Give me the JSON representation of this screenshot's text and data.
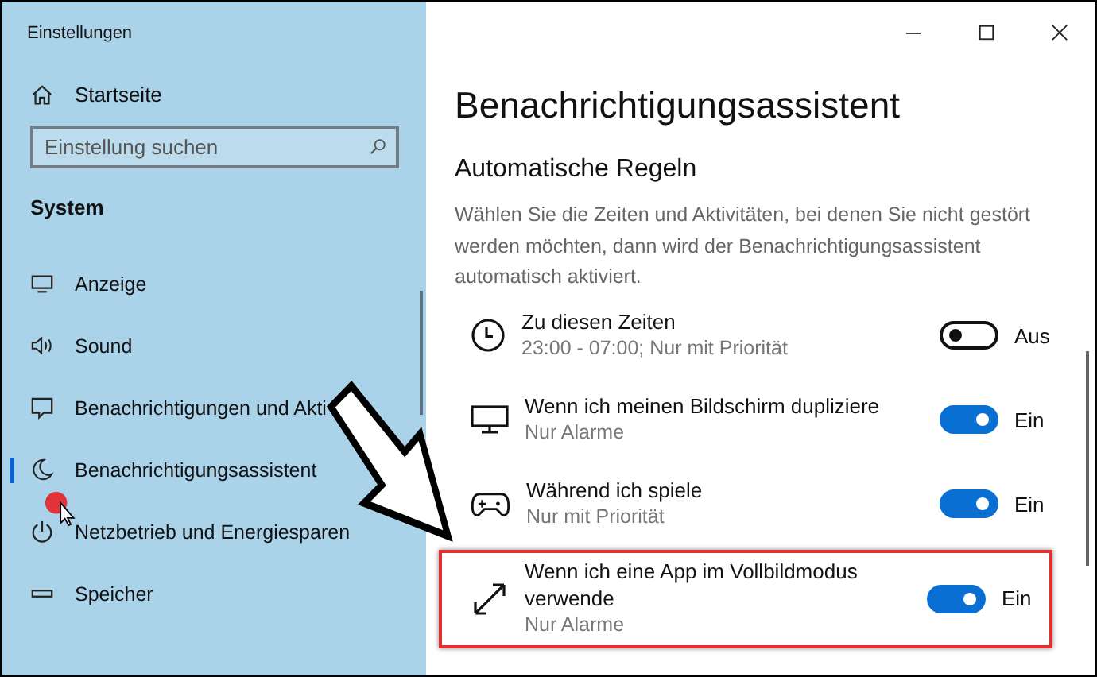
{
  "window": {
    "title": "Einstellungen"
  },
  "sidebar": {
    "home": {
      "label": "Startseite"
    },
    "search": {
      "placeholder": "Einstellung suchen"
    },
    "section": "System",
    "items": [
      {
        "kind": "display",
        "label": "Anzeige",
        "selected": false
      },
      {
        "kind": "sound",
        "label": "Sound",
        "selected": false
      },
      {
        "kind": "notifications",
        "label": "Benachrichtigungen und Akti",
        "selected": false
      },
      {
        "kind": "moon",
        "label": "Benachrichtigungsassistent",
        "selected": true
      },
      {
        "kind": "power",
        "label": "Netzbetrieb und Energiesparen",
        "selected": false
      },
      {
        "kind": "storage",
        "label": "Speicher",
        "selected": false
      }
    ]
  },
  "content": {
    "title": "Benachrichtigungsassistent",
    "heading": "Automatische Regeln",
    "description": "Wählen Sie die Zeiten und Aktivitäten, bei denen Sie nicht gestört werden möchten, dann wird der Benachrichtigungsassistent automatisch aktiviert.",
    "rules": [
      {
        "kind": "clock",
        "title": "Zu diesen Zeiten",
        "subtitle": "23:00 - 07:00; Nur mit Priorität",
        "on": false,
        "state_label": "Aus",
        "highlighted": false
      },
      {
        "kind": "monitor",
        "title": "Wenn ich meinen Bildschirm dupliziere",
        "subtitle": "Nur Alarme",
        "on": true,
        "state_label": "Ein",
        "highlighted": false
      },
      {
        "kind": "gamepad",
        "title": "Während ich spiele",
        "subtitle": "Nur mit Priorität",
        "on": true,
        "state_label": "Ein",
        "highlighted": false
      },
      {
        "kind": "fullscreen",
        "title": "Wenn ich eine App im Vollbildmodus verwende",
        "subtitle": "Nur Alarme",
        "on": true,
        "state_label": "Ein",
        "highlighted": true
      }
    ]
  }
}
